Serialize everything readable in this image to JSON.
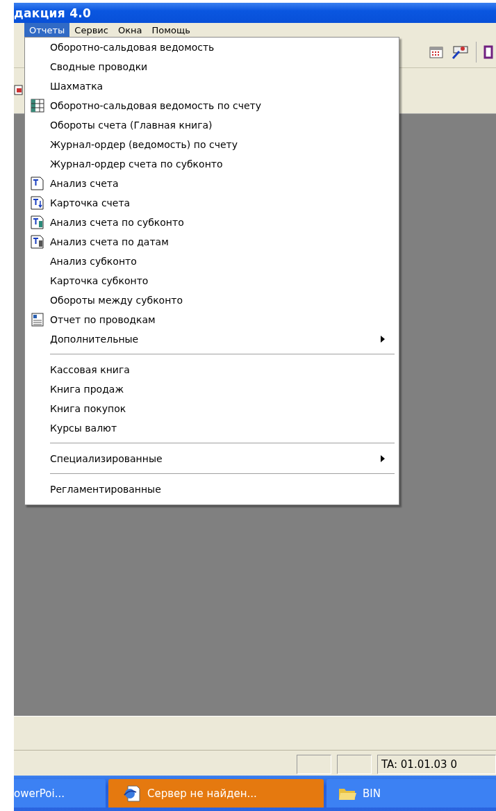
{
  "window": {
    "title": "дакция 4.0"
  },
  "menu_bar": [
    {
      "label": "Отчеты",
      "selected": true
    },
    {
      "label": "Сервис",
      "selected": false
    },
    {
      "label": "Окна",
      "selected": false
    },
    {
      "label": "Помощь",
      "selected": false
    }
  ],
  "menu": [
    {
      "kind": "item",
      "label": "Оборотно-сальдовая ведомость"
    },
    {
      "kind": "item",
      "label": "Сводные проводки"
    },
    {
      "kind": "item",
      "label": "Шахматка"
    },
    {
      "kind": "icon-item",
      "label": "Оборотно-сальдовая ведомость по счету"
    },
    {
      "kind": "item",
      "label": "Обороты счета (Главная книга)"
    },
    {
      "kind": "item",
      "label": "Журнал-ордер (ведомость) по счету"
    },
    {
      "kind": "item",
      "label": "Журнал-ордер счета по субконто"
    },
    {
      "kind": "icon-item",
      "label": "Анализ счета"
    },
    {
      "kind": "icon-item",
      "label": "Карточка счета"
    },
    {
      "kind": "icon-item",
      "label": "Анализ счета по субконто"
    },
    {
      "kind": "icon-item",
      "label": "Анализ счета по датам"
    },
    {
      "kind": "item",
      "label": "Анализ субконто"
    },
    {
      "kind": "item",
      "label": "Карточка субконто"
    },
    {
      "kind": "item",
      "label": "Обороты между субконто"
    },
    {
      "kind": "icon-item",
      "label": "Отчет по проводкам"
    },
    {
      "kind": "submenu",
      "label": "Дополнительные"
    },
    {
      "kind": "separator"
    },
    {
      "kind": "item",
      "label": "Кассовая книга"
    },
    {
      "kind": "item",
      "label": "Книга продаж"
    },
    {
      "kind": "item",
      "label": "Книга покупок"
    },
    {
      "kind": "item",
      "label": "Курсы валют"
    },
    {
      "kind": "separator"
    },
    {
      "kind": "submenu",
      "label": "Специализированные"
    },
    {
      "kind": "separator"
    },
    {
      "kind": "item",
      "label": "Регламентированные"
    }
  ],
  "status_bar": {
    "panel_3": "TA: 01.01.03 0"
  },
  "taskbar": [
    {
      "label": "owerPoi...",
      "selected": false,
      "kind": "powerpoint"
    },
    {
      "label": "Сервер не найден...",
      "selected": true,
      "kind": "browser"
    },
    {
      "label": "BIN",
      "selected": false,
      "kind": "folder"
    }
  ]
}
